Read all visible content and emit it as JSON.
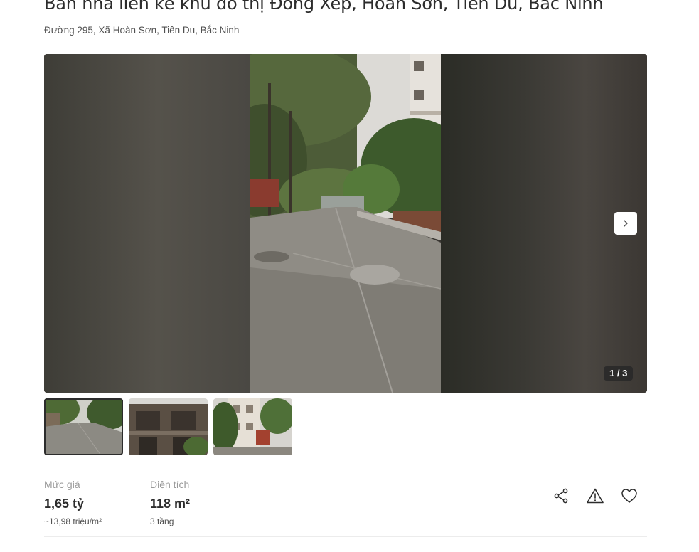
{
  "listing": {
    "title": "Bán nhà liền kề khu đô thị Đồng Xép, Hoàn Sơn, Tiên Du, Bắc Ninh",
    "address": "Đường 295, Xã Hoàn Sơn, Tiên Du, Bắc Ninh"
  },
  "gallery": {
    "counter": "1 / 3",
    "next_icon": "chevron-right-icon",
    "thumbnails": [
      {
        "name": "thumbnail-street",
        "active": true
      },
      {
        "name": "thumbnail-house",
        "active": false
      },
      {
        "name": "thumbnail-building",
        "active": false
      }
    ]
  },
  "price": {
    "label": "Mức giá",
    "value": "1,65 tỷ",
    "sub": "~13,98 triệu/m²"
  },
  "area": {
    "label": "Diện tích",
    "value": "118 m²",
    "sub": "3 tầng"
  },
  "actions": [
    "share-icon",
    "report-icon",
    "favorite-icon"
  ],
  "colors": {
    "text": "#2c2c2c",
    "muted": "#999999",
    "divider": "#ececec"
  }
}
